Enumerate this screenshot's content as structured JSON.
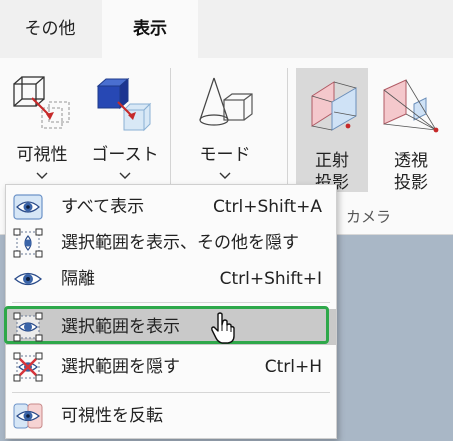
{
  "tabs": [
    {
      "label": "その他"
    },
    {
      "label": "表示"
    }
  ],
  "ribbon": {
    "visibility_label": "可視性",
    "ghost_label": "ゴースト",
    "mode_label": "モード",
    "ortho_label_line1": "正射",
    "ortho_label_line2": "投影",
    "persp_label_line1": "透視",
    "persp_label_line2": "投影",
    "camera_group_label": "カメラ"
  },
  "menu": {
    "items": [
      {
        "label": "すべて表示",
        "shortcut": "Ctrl+Shift+A"
      },
      {
        "label": "選択範囲を表示、その他を隠す",
        "shortcut": ""
      },
      {
        "label": "隔離",
        "shortcut": "Ctrl+Shift+I"
      },
      {
        "label": "選択範囲を表示",
        "shortcut": ""
      },
      {
        "label": "選択範囲を隠す",
        "shortcut": "Ctrl+H"
      },
      {
        "label": "可視性を反転",
        "shortcut": ""
      }
    ]
  },
  "colors": {
    "highlight_border": "#2ea84a",
    "eye_blue": "#3a64a8",
    "hide_red": "#d7333a"
  }
}
